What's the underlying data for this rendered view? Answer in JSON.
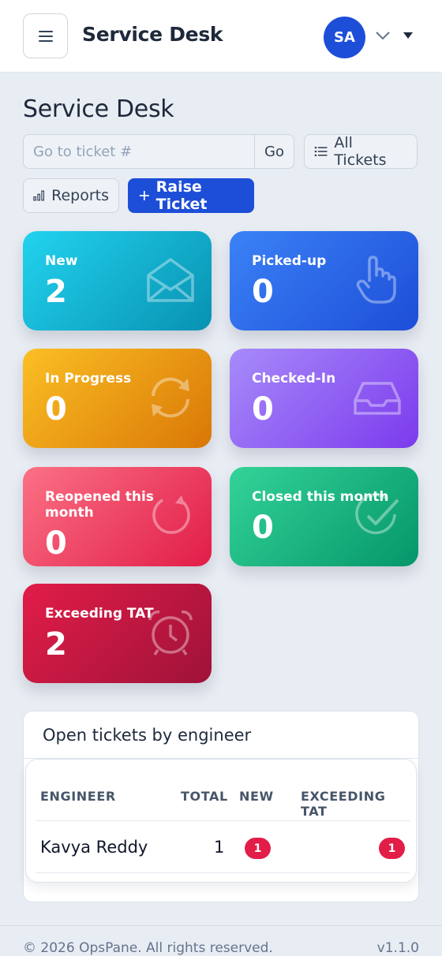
{
  "header": {
    "app_title": "Service Desk",
    "avatar_initials": "SA"
  },
  "page": {
    "title": "Service Desk"
  },
  "toolbar": {
    "ticket_search_placeholder": "Go to ticket #",
    "go_label": "Go",
    "all_tickets_label": "All Tickets",
    "reports_label": "Reports",
    "raise_ticket_label": "Raise Ticket"
  },
  "cards": [
    {
      "label": "New",
      "value": "2",
      "icon": "envelope-open-icon",
      "color": "#0ea5c6"
    },
    {
      "label": "Picked-up",
      "value": "0",
      "icon": "hand-pointer-icon",
      "color": "#2563eb"
    },
    {
      "label": "In Progress",
      "value": "0",
      "icon": "refresh-icon",
      "color": "#f59e0b"
    },
    {
      "label": "Checked-In",
      "value": "0",
      "icon": "inbox-icon",
      "color": "#8b5cf6"
    },
    {
      "label": "Reopened this month",
      "value": "0",
      "icon": "reopen-circle-icon",
      "color": "#f43f5e"
    },
    {
      "label": "Closed this month",
      "value": "0",
      "icon": "check-circle-icon",
      "color": "#10b981"
    },
    {
      "label": "Exceeding TAT",
      "value": "2",
      "icon": "alarm-clock-icon",
      "color": "#be123c"
    }
  ],
  "engineer_table": {
    "title": "Open tickets by engineer",
    "columns": [
      "ENGINEER",
      "TOTAL",
      "NEW",
      "EXCEEDING TAT"
    ],
    "rows": [
      {
        "engineer": "Kavya Reddy",
        "total": "1",
        "new": "1",
        "exceeding_tat": "1"
      }
    ]
  },
  "footer": {
    "copyright": "© 2026 OpsPane. All rights reserved.",
    "version": "v1.1.0"
  }
}
